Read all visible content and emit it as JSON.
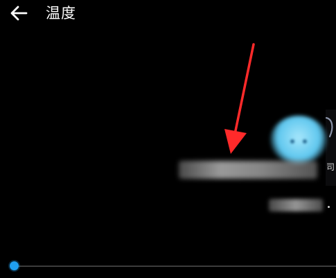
{
  "header": {
    "title": "温度",
    "back_icon": "arrow-left-icon"
  },
  "card": {
    "edge_text": "司"
  },
  "slider": {
    "value_fraction": 0.0,
    "accent_color": "#1f9ff0"
  },
  "colors": {
    "background": "#000000",
    "annotation": "#ff2020",
    "avatar": "#5dc6ee"
  }
}
